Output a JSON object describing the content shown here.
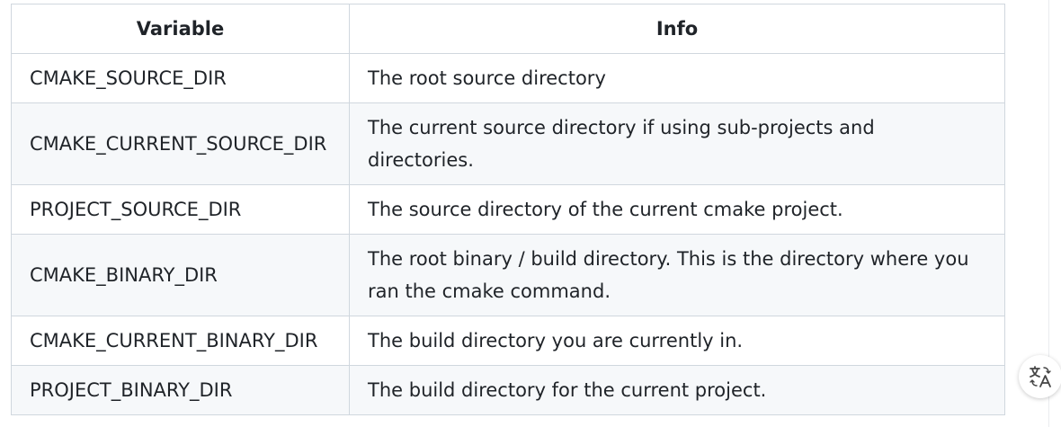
{
  "table": {
    "headers": [
      "Variable",
      "Info"
    ],
    "rows": [
      {
        "variable": "CMAKE_SOURCE_DIR",
        "info": "The root source directory"
      },
      {
        "variable": "CMAKE_CURRENT_SOURCE_DIR",
        "info": "The current source directory if using sub-projects and directories."
      },
      {
        "variable": "PROJECT_SOURCE_DIR",
        "info": "The source directory of the current cmake project."
      },
      {
        "variable": "CMAKE_BINARY_DIR",
        "info": "The root binary / build directory. This is the directory where you ran the cmake command."
      },
      {
        "variable": "CMAKE_CURRENT_BINARY_DIR",
        "info": "The build directory you are currently in."
      },
      {
        "variable": "PROJECT_BINARY_DIR",
        "info": "The build directory for the current project."
      }
    ]
  },
  "floating_button": {
    "icon": "translate-icon"
  },
  "colors": {
    "border": "#d0d7de",
    "striped_row": "#f6f8fa",
    "text": "#1f2328"
  }
}
